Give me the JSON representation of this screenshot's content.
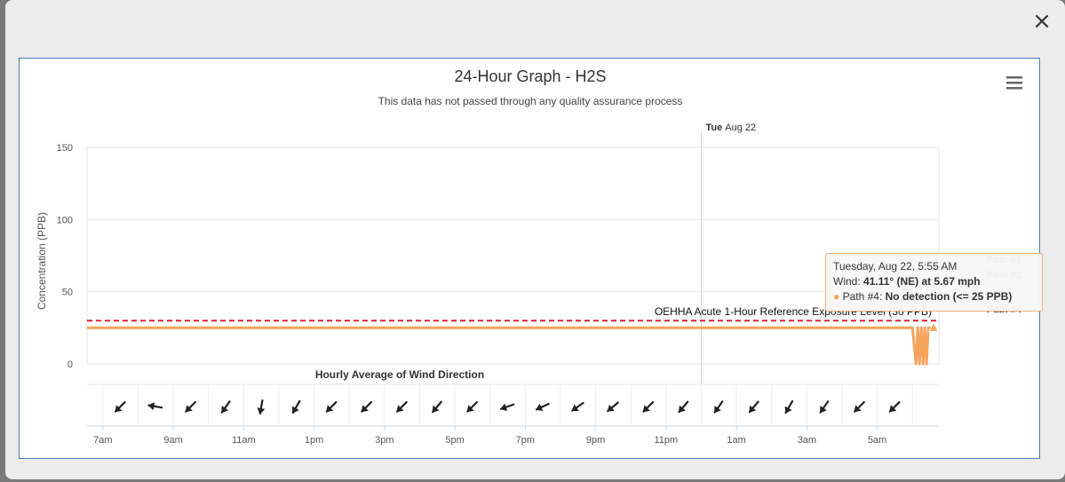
{
  "dialog": {
    "close_glyph": "×"
  },
  "menu": {
    "icon": "hamburger-menu-icon"
  },
  "tooltip": {
    "time": "Tuesday, Aug 22, 5:55 AM",
    "wind_label": "Wind: ",
    "wind_value": "41.11° (NE) at 5.67 mph",
    "path_label": "Path #4: ",
    "path_value": "No detection (<= 25 PPB)"
  },
  "colors": {
    "series": "#f7a35c",
    "reference_line": "#e0202a",
    "tooltip_border": "#f0b07a",
    "panel_border": "#4d7bb7"
  },
  "chart_data": {
    "type": "line",
    "title": "24-Hour Graph - H2S",
    "subtitle": "This data has not passed through any quality assurance process",
    "ylabel": "Concentration (PPB)",
    "ylim": [
      0,
      150
    ],
    "yticks": [
      0,
      50,
      100,
      150
    ],
    "x_range_hours": [
      6.55,
      30.75
    ],
    "xticks": [
      {
        "h": 7,
        "label": "7am"
      },
      {
        "h": 9,
        "label": "9am"
      },
      {
        "h": 11,
        "label": "11am"
      },
      {
        "h": 13,
        "label": "1pm"
      },
      {
        "h": 15,
        "label": "3pm"
      },
      {
        "h": 17,
        "label": "5pm"
      },
      {
        "h": 19,
        "label": "7pm"
      },
      {
        "h": 21,
        "label": "9pm"
      },
      {
        "h": 23,
        "label": "11pm"
      },
      {
        "h": 25,
        "label": "1am"
      },
      {
        "h": 27,
        "label": "3am"
      },
      {
        "h": 29,
        "label": "5am"
      }
    ],
    "day_marker": {
      "h": 24,
      "day": "Tue",
      "date": "Aug 22"
    },
    "grid": true,
    "reference_line": {
      "value": 30,
      "label": "OEHHA Acute 1-Hour Reference Exposure Level (30 PPB)",
      "style": "dashed"
    },
    "series": [
      {
        "name": "Path #4",
        "points": [
          [
            6.55,
            25
          ],
          [
            30.0,
            25
          ],
          [
            30.1,
            0
          ],
          [
            30.15,
            25
          ],
          [
            30.2,
            0
          ],
          [
            30.25,
            25
          ],
          [
            30.3,
            0
          ],
          [
            30.35,
            25
          ],
          [
            30.4,
            0
          ],
          [
            30.45,
            25
          ],
          [
            30.6,
            25
          ]
        ]
      }
    ],
    "legend": {
      "position": "right",
      "items": [
        "Path #1",
        "Path #2",
        "Path #4"
      ]
    },
    "wind_panel": {
      "title": "Hourly Average of Wind Direction",
      "arrows": [
        {
          "h": 7.5,
          "dir_deg": 45
        },
        {
          "h": 8.5,
          "dir_deg": 100
        },
        {
          "h": 9.5,
          "dir_deg": 45
        },
        {
          "h": 10.5,
          "dir_deg": 35
        },
        {
          "h": 11.5,
          "dir_deg": 10
        },
        {
          "h": 12.5,
          "dir_deg": 30
        },
        {
          "h": 13.5,
          "dir_deg": 45
        },
        {
          "h": 14.5,
          "dir_deg": 45
        },
        {
          "h": 15.5,
          "dir_deg": 45
        },
        {
          "h": 16.5,
          "dir_deg": 40
        },
        {
          "h": 17.5,
          "dir_deg": 45
        },
        {
          "h": 18.5,
          "dir_deg": 70
        },
        {
          "h": 19.5,
          "dir_deg": 65
        },
        {
          "h": 20.5,
          "dir_deg": 55
        },
        {
          "h": 21.5,
          "dir_deg": 50
        },
        {
          "h": 22.5,
          "dir_deg": 45
        },
        {
          "h": 23.5,
          "dir_deg": 40
        },
        {
          "h": 24.5,
          "dir_deg": 35
        },
        {
          "h": 25.5,
          "dir_deg": 40
        },
        {
          "h": 26.5,
          "dir_deg": 30
        },
        {
          "h": 27.5,
          "dir_deg": 35
        },
        {
          "h": 28.5,
          "dir_deg": 45
        },
        {
          "h": 29.5,
          "dir_deg": 45
        }
      ]
    }
  }
}
